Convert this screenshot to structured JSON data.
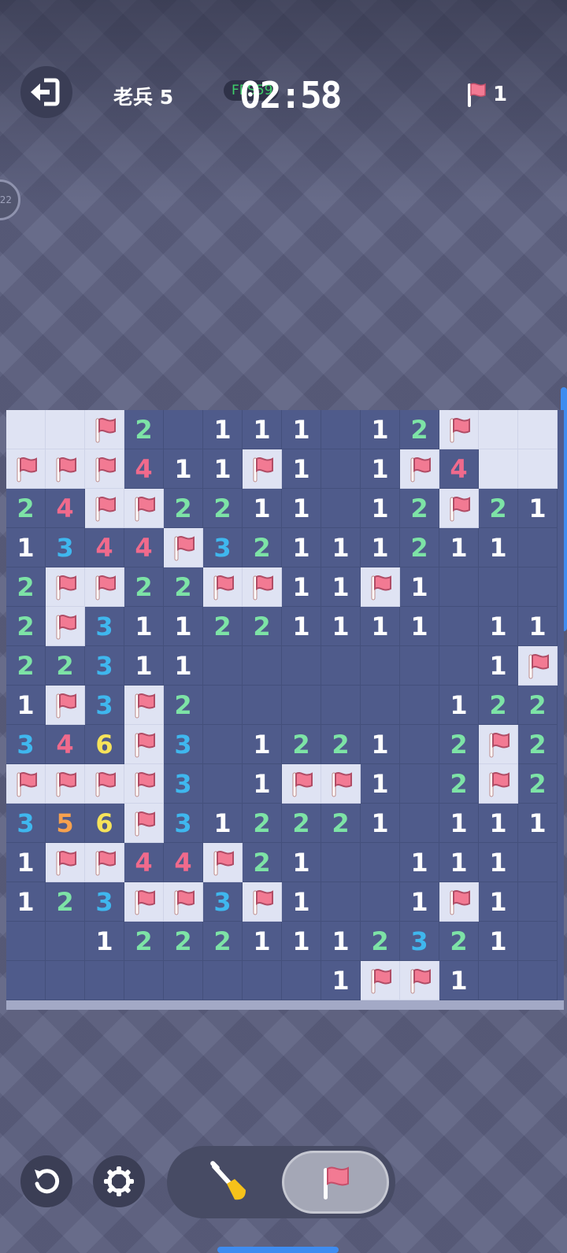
{
  "header": {
    "level_label": "老兵 5",
    "fps_label": "FPS59",
    "timer": "02:58",
    "flags_remaining": "1"
  },
  "side_badge": {
    "label": "22"
  },
  "colors": {
    "revealed_cell": "#4f5b8b",
    "hidden_cell": "#dfe3f3",
    "number_1": "#ffffff",
    "number_2": "#7de3a6",
    "number_3": "#3fb7ee",
    "number_4": "#f06a8c",
    "number_5": "#f6a14e",
    "number_6": "#f6e35a",
    "flag": "#f27a93"
  },
  "board": {
    "rows": 15,
    "cols": 14,
    "legend": "H = hidden, F = flagged, . = empty revealed, digit = count",
    "grid": [
      [
        "H",
        "H",
        "F",
        "2",
        ".",
        "1",
        "1",
        "1",
        ".",
        "1",
        "2",
        "F",
        "H",
        "H"
      ],
      [
        "F",
        "F",
        "F",
        "4",
        "1",
        "1",
        "F",
        "1",
        ".",
        "1",
        "F",
        "4",
        "H",
        "H"
      ],
      [
        "2",
        "4",
        "F",
        "F",
        "2",
        "2",
        "1",
        "1",
        ".",
        "1",
        "2",
        "F",
        "2",
        "1"
      ],
      [
        "1",
        "3",
        "4",
        "4",
        "F",
        "3",
        "2",
        "1",
        "1",
        "1",
        "2",
        "1",
        "1",
        "."
      ],
      [
        "2",
        "F",
        "F",
        "2",
        "2",
        "F",
        "F",
        "1",
        "1",
        "F",
        "1",
        ".",
        ".",
        "."
      ],
      [
        "2",
        "F",
        "3",
        "1",
        "1",
        "2",
        "2",
        "1",
        "1",
        "1",
        "1",
        ".",
        "1",
        "1"
      ],
      [
        "2",
        "2",
        "3",
        "1",
        "1",
        ".",
        ".",
        ".",
        ".",
        ".",
        ".",
        ".",
        "1",
        "F"
      ],
      [
        "1",
        "F",
        "3",
        "F",
        "2",
        ".",
        ".",
        ".",
        ".",
        ".",
        ".",
        "1",
        "2",
        "2"
      ],
      [
        "3",
        "4",
        "6",
        "F",
        "3",
        ".",
        "1",
        "2",
        "2",
        "1",
        ".",
        "2",
        "F",
        "2"
      ],
      [
        "F",
        "F",
        "F",
        "F",
        "3",
        ".",
        "1",
        "F",
        "F",
        "1",
        ".",
        "2",
        "F",
        "2"
      ],
      [
        "3",
        "5",
        "6",
        "F",
        "3",
        "1",
        "2",
        "2",
        "2",
        "1",
        ".",
        "1",
        "1",
        "1"
      ],
      [
        "1",
        "F",
        "F",
        "4",
        "4",
        "F",
        "2",
        "1",
        ".",
        ".",
        "1",
        "1",
        "1",
        "."
      ],
      [
        "1",
        "2",
        "3",
        "F",
        "F",
        "3",
        "F",
        "1",
        ".",
        ".",
        "1",
        "F",
        "1",
        "."
      ],
      [
        ".",
        ".",
        "1",
        "2",
        "2",
        "2",
        "1",
        "1",
        "1",
        "2",
        "3",
        "2",
        "1",
        "."
      ],
      [
        ".",
        ".",
        ".",
        ".",
        ".",
        ".",
        ".",
        ".",
        "1",
        "F",
        "F",
        "1",
        ".",
        "."
      ]
    ]
  },
  "toolbar": {
    "undo_icon": "undo-icon",
    "settings_icon": "gear-icon",
    "dig_icon": "shovel-icon",
    "flag_icon": "flag-icon",
    "active_mode": "flag"
  }
}
